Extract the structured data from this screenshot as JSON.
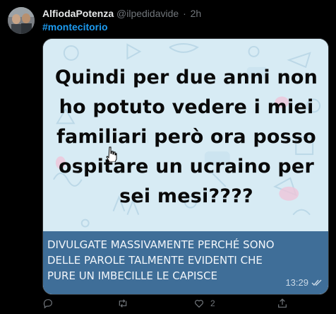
{
  "tweet": {
    "display_name": "AlfiodaPotenza",
    "handle": "@ilpedidavide",
    "separator": "·",
    "time": "2h",
    "hashtag": "#montecitorio"
  },
  "media": {
    "meme_lines": [
      "Quindi per due anni non",
      "ho potuto vedere i miei",
      "familiari però ora posso",
      "ospitare un ucraino per",
      "sei mesi????"
    ],
    "caption_lines": [
      "DIVULGATE MASSIVAMENTE PERCHÉ SONO",
      "DELLE PAROLE TALMENTE EVIDENTI CHE",
      "PURE UN IMBECILLE LE CAPISCE"
    ],
    "message_time": "13:29"
  },
  "actions": {
    "reply": {
      "icon": "reply-icon",
      "count": ""
    },
    "retweet": {
      "icon": "retweet-icon",
      "count": ""
    },
    "like": {
      "icon": "heart-icon",
      "count": "2"
    },
    "share": {
      "icon": "share-icon",
      "count": ""
    }
  },
  "colors": {
    "background": "#000000",
    "name": "#e7e9ea",
    "secondary": "#71767b",
    "link": "#1d9bf0",
    "caption_bg": "#3f6e98",
    "image_bg": "#d9ecf5"
  }
}
